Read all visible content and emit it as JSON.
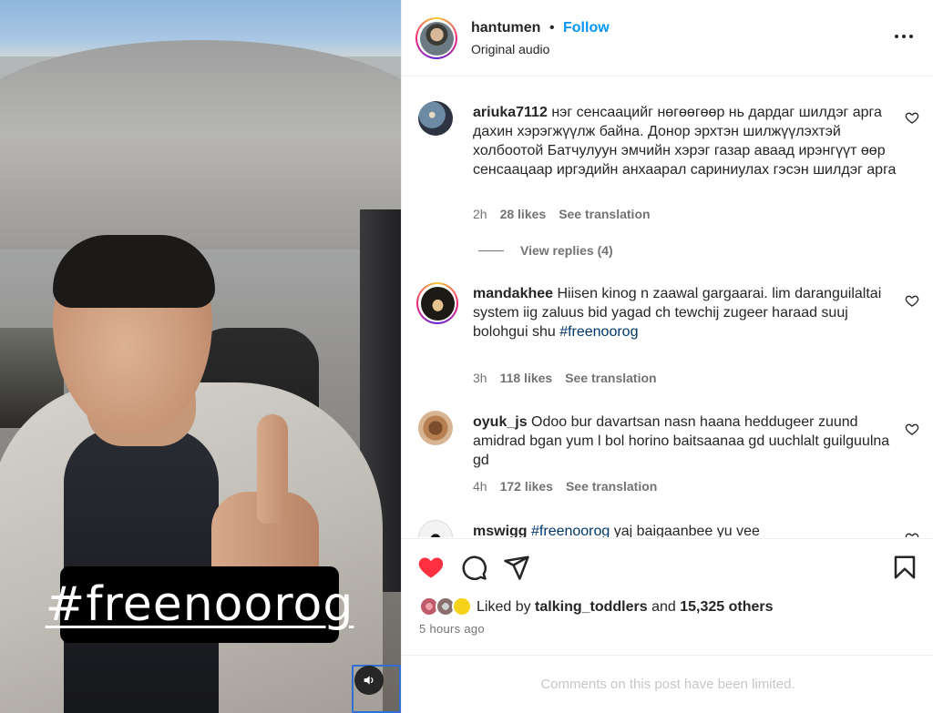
{
  "video": {
    "overlay_text": "#freenoorog",
    "mute_icon": "speaker-icon"
  },
  "header": {
    "username": "hantumen",
    "separator": "•",
    "follow_label": "Follow",
    "audio_label": "Original audio",
    "more_icon": "more-options-icon"
  },
  "comments": [
    {
      "username": "ariuka7112",
      "text": "нэг сенсаацийг нөгөөгөөр нь дардаг шилдэг арга дахин хэрэгжүүлж байна. Донор эрхтэн шилжүүлэхтэй холбоотой Батчулуун эмчийн хэрэг газар аваад ирэнгүүт өөр сенсаацаар иргэдийн анхаарал сариниулах гэсэн шилдэг арга",
      "time": "2h",
      "likes": "28 likes",
      "translate": "See translation",
      "view_replies": "View replies (4)"
    },
    {
      "username": "mandakhee",
      "text_a": "Hiisen kinog n zaawal gargaarai. lim daranguilaltai system iig zaluus bid yagad ch tewchij zugeer haraad suuj",
      "text_b": "bolohgui shu ",
      "tag": "#freenoorog",
      "time": "3h",
      "likes": "118 likes",
      "translate": "See translation"
    },
    {
      "username": "oyuk_js",
      "text": "Odoo bur davartsan nasn haana heddugeer zuund amidrad bgan yum l bol horino baitsaanaa gd uuchlalt guilguulna gd",
      "time": "4h",
      "likes": "172 likes",
      "translate": "See translation"
    },
    {
      "username": "mswigg",
      "tag": "#freenoorog",
      "text": " yaj baigaanbee yu vee"
    }
  ],
  "actions": {
    "liked_by_prefix": "Liked by ",
    "liked_by_user": "talking_toddlers",
    "liked_by_and": " and ",
    "liked_by_others": "15,325 others",
    "timestamp": "5 hours ago"
  },
  "footer": {
    "limited_text": "Comments on this post have been limited."
  },
  "colors": {
    "follow_blue": "#0095f6",
    "like_red": "#ff3040",
    "hashtag_blue": "#00376b",
    "secondary_text": "#737373"
  }
}
